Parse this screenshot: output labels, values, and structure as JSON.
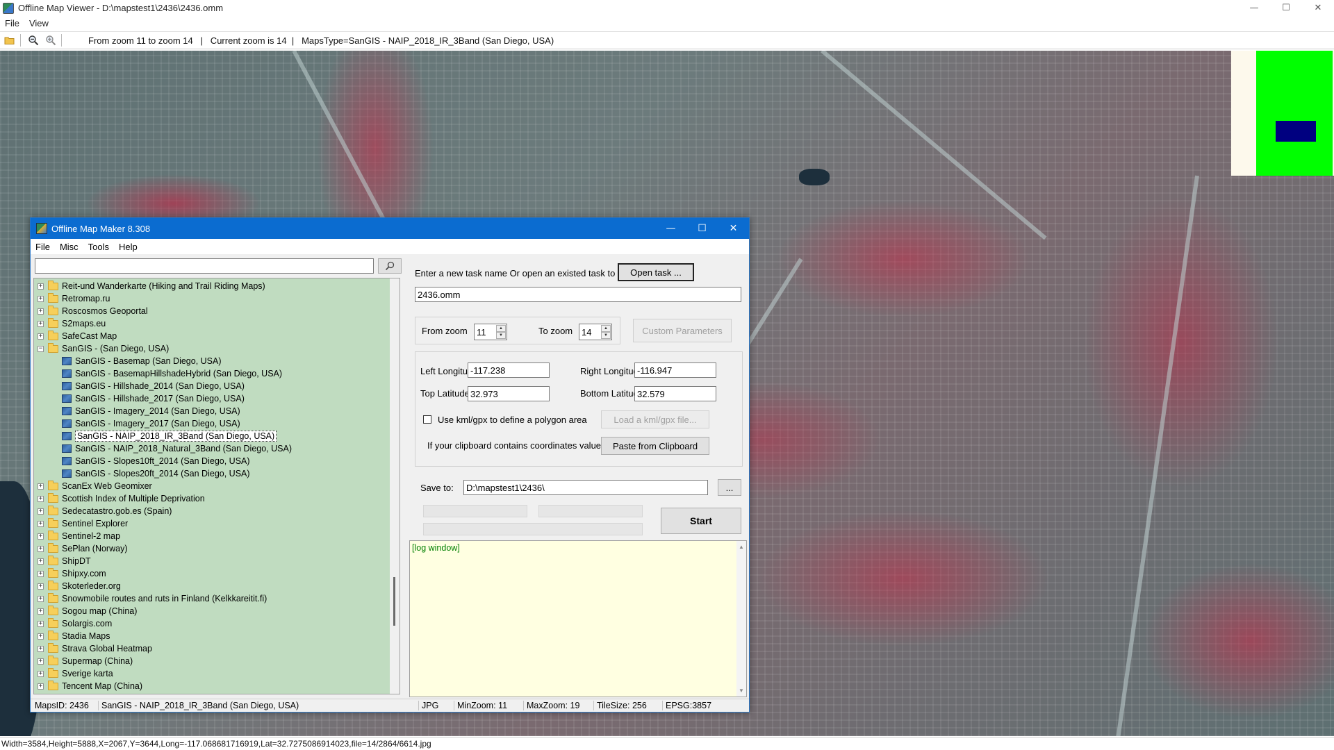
{
  "viewer": {
    "title": "Offline Map Viewer - D:\\mapstest1\\2436\\2436.omm",
    "menu": [
      "File",
      "View"
    ],
    "toolbar_status": "From zoom 11 to zoom 14   |   Current zoom is 14  |   MapsType=SanGIS - NAIP_2018_IR_3Band (San Diego, USA)",
    "status_bar": "Width=3584,Height=5888,X=2067,Y=3644,Long=-117.068681716919,Lat=32.7275086914023,file=14/2864/6614.jpg",
    "window_controls": {
      "minimize": "—",
      "maximize": "☐",
      "close": "✕"
    },
    "colors": {
      "overview_bg": "#fdf9ec",
      "overview_green": "#00ff00",
      "overview_rect": "#000080"
    }
  },
  "dialog": {
    "title": "Offline Map Maker 8.308",
    "menu": [
      "File",
      "Misc",
      "Tools",
      "Help"
    ],
    "window_controls": {
      "minimize": "—",
      "maximize": "☐",
      "close": "✕"
    },
    "search": {
      "value": "",
      "placeholder": ""
    },
    "tree": [
      {
        "label": "Reit-und Wanderkarte (Hiking and Trail Riding Maps)",
        "type": "folder",
        "level": 0,
        "expander": "+"
      },
      {
        "label": "Retromap.ru",
        "type": "folder",
        "level": 0,
        "expander": "+"
      },
      {
        "label": "Roscosmos Geoportal",
        "type": "folder",
        "level": 0,
        "expander": "+"
      },
      {
        "label": "S2maps.eu",
        "type": "folder",
        "level": 0,
        "expander": "+"
      },
      {
        "label": "SafeCast Map",
        "type": "folder",
        "level": 0,
        "expander": "+"
      },
      {
        "label": "SanGIS - (San Diego, USA)",
        "type": "folder",
        "level": 0,
        "expander": "−"
      },
      {
        "label": "SanGIS - Basemap (San Diego, USA)",
        "type": "map",
        "level": 1
      },
      {
        "label": "SanGIS - BasemapHillshadeHybrid (San Diego, USA)",
        "type": "map",
        "level": 1
      },
      {
        "label": "SanGIS - Hillshade_2014 (San Diego, USA)",
        "type": "map",
        "level": 1
      },
      {
        "label": "SanGIS - Hillshade_2017 (San Diego, USA)",
        "type": "map",
        "level": 1
      },
      {
        "label": "SanGIS - Imagery_2014 (San Diego, USA)",
        "type": "map",
        "level": 1
      },
      {
        "label": "SanGIS - Imagery_2017 (San Diego, USA)",
        "type": "map",
        "level": 1
      },
      {
        "label": "SanGIS - NAIP_2018_IR_3Band (San Diego, USA)",
        "type": "map",
        "level": 1,
        "selected": true
      },
      {
        "label": "SanGIS - NAIP_2018_Natural_3Band (San Diego, USA)",
        "type": "map",
        "level": 1
      },
      {
        "label": "SanGIS - Slopes10ft_2014 (San Diego, USA)",
        "type": "map",
        "level": 1
      },
      {
        "label": "SanGIS - Slopes20ft_2014 (San Diego, USA)",
        "type": "map",
        "level": 1
      },
      {
        "label": "ScanEx Web Geomixer",
        "type": "folder",
        "level": 0,
        "expander": "+"
      },
      {
        "label": "Scottish Index of Multiple Deprivation",
        "type": "folder",
        "level": 0,
        "expander": "+"
      },
      {
        "label": "Sedecatastro.gob.es (Spain)",
        "type": "folder",
        "level": 0,
        "expander": "+"
      },
      {
        "label": "Sentinel Explorer",
        "type": "folder",
        "level": 0,
        "expander": "+"
      },
      {
        "label": "Sentinel-2 map",
        "type": "folder",
        "level": 0,
        "expander": "+"
      },
      {
        "label": "SePlan (Norway)",
        "type": "folder",
        "level": 0,
        "expander": "+"
      },
      {
        "label": "ShipDT",
        "type": "folder",
        "level": 0,
        "expander": "+"
      },
      {
        "label": "Shipxy.com",
        "type": "folder",
        "level": 0,
        "expander": "+"
      },
      {
        "label": "Skoterleder.org",
        "type": "folder",
        "level": 0,
        "expander": "+"
      },
      {
        "label": "Snowmobile routes and ruts in Finland (Kelkkareitit.fi)",
        "type": "folder",
        "level": 0,
        "expander": "+"
      },
      {
        "label": "Sogou map (China)",
        "type": "folder",
        "level": 0,
        "expander": "+"
      },
      {
        "label": "Solargis.com",
        "type": "folder",
        "level": 0,
        "expander": "+"
      },
      {
        "label": "Stadia Maps",
        "type": "folder",
        "level": 0,
        "expander": "+"
      },
      {
        "label": "Strava Global Heatmap",
        "type": "folder",
        "level": 0,
        "expander": "+"
      },
      {
        "label": "Supermap (China)",
        "type": "folder",
        "level": 0,
        "expander": "+"
      },
      {
        "label": "Sverige karta",
        "type": "folder",
        "level": 0,
        "expander": "+"
      },
      {
        "label": "Tencent Map (China)",
        "type": "folder",
        "level": 0,
        "expander": "+"
      }
    ],
    "task": {
      "prompt": "Enter a new task name Or open an existed task to continue:",
      "open_button": "Open task ...",
      "name_value": "2436.omm"
    },
    "zoom": {
      "from_label": "From zoom",
      "from_value": "11",
      "to_label": "To zoom",
      "to_value": "14",
      "custom_button": "Custom Parameters"
    },
    "coords": {
      "left_lon_label": "Left Longitude",
      "left_lon_value": "-117.238",
      "right_lon_label": "Right Longitude",
      "right_lon_value": "-116.947",
      "top_lat_label": "Top Latitude",
      "top_lat_value": "32.973",
      "bottom_lat_label": "Bottom Latitude",
      "bottom_lat_value": "32.579",
      "kml_checkbox_label": "Use kml/gpx to define a polygon area",
      "kml_button": "Load a kml/gpx file...",
      "clipboard_label": "If your clipboard contains coordinates values:",
      "clipboard_button": "Paste from Clipboard"
    },
    "save": {
      "label": "Save to:",
      "path_value": "D:\\mapstest1\\2436\\",
      "browse_button": "...",
      "start_button": "Start"
    },
    "log": {
      "text": "[log window]"
    },
    "status": {
      "maps_id": "MapsID: 2436",
      "maps_name": "SanGIS - NAIP_2018_IR_3Band (San Diego, USA)",
      "format": "JPG",
      "min_zoom": "MinZoom: 11",
      "max_zoom": "MaxZoom: 19",
      "tile_size": "TileSize: 256",
      "epsg": "EPSG:3857"
    }
  }
}
